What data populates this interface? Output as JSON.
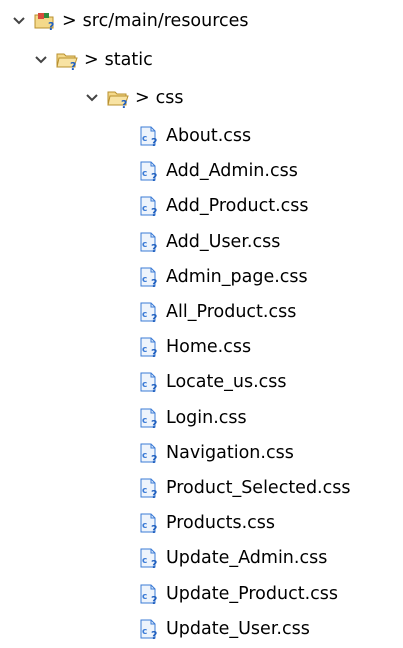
{
  "tree": {
    "separator": ">",
    "source_folder": {
      "label": "src/main/resources"
    },
    "static_folder": {
      "label": "static"
    },
    "css_folder": {
      "label": "css"
    },
    "files": [
      {
        "label": "About.css"
      },
      {
        "label": "Add_Admin.css"
      },
      {
        "label": "Add_Product.css"
      },
      {
        "label": "Add_User.css"
      },
      {
        "label": "Admin_page.css"
      },
      {
        "label": "All_Product.css"
      },
      {
        "label": "Home.css"
      },
      {
        "label": "Locate_us.css"
      },
      {
        "label": "Login.css"
      },
      {
        "label": "Navigation.css"
      },
      {
        "label": "Product_Selected.css"
      },
      {
        "label": "Products.css"
      },
      {
        "label": "Update_Admin.css"
      },
      {
        "label": "Update_Product.css"
      },
      {
        "label": "Update_User.css"
      }
    ]
  },
  "icons": {
    "expand": "chevron-down-icon",
    "source_folder": "source-folder-unknown-icon",
    "folder": "folder-unknown-icon",
    "file": "css-file-unknown-icon"
  },
  "colors": {
    "folder_fill": "#f4d98a",
    "folder_stroke": "#b9902e",
    "question_mark": "#1f5fbf",
    "file_blue": "#3b7bd6"
  }
}
